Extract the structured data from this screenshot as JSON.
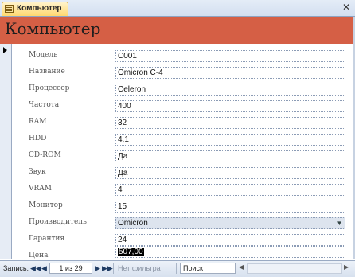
{
  "tab": {
    "label": "Компьютер"
  },
  "header": {
    "title": "Компьютер"
  },
  "fields": [
    {
      "label": "Модель",
      "value": "C001"
    },
    {
      "label": "Название",
      "value": "Omicron C-4"
    },
    {
      "label": "Процессор",
      "value": "Celeron"
    },
    {
      "label": "Частота",
      "value": "400"
    },
    {
      "label": "RAM",
      "value": "32"
    },
    {
      "label": "HDD",
      "value": "4,1"
    },
    {
      "label": "CD-ROM",
      "value": "Да"
    },
    {
      "label": "Звук",
      "value": "Да"
    },
    {
      "label": "VRAM",
      "value": "4"
    },
    {
      "label": "Монитор",
      "value": "15"
    },
    {
      "label": "Производитель",
      "value": "Omicron"
    },
    {
      "label": "Гарантия",
      "value": "24"
    },
    {
      "label": "Цена",
      "value": "507,00"
    }
  ],
  "navbar": {
    "label": "Запись:",
    "first": "◀◀",
    "prev": "◀",
    "counter": "1 из 29",
    "next": "▶",
    "last": "▶▶",
    "new": "▶✱",
    "filter": "Нет фильтра",
    "search": "Поиск"
  }
}
